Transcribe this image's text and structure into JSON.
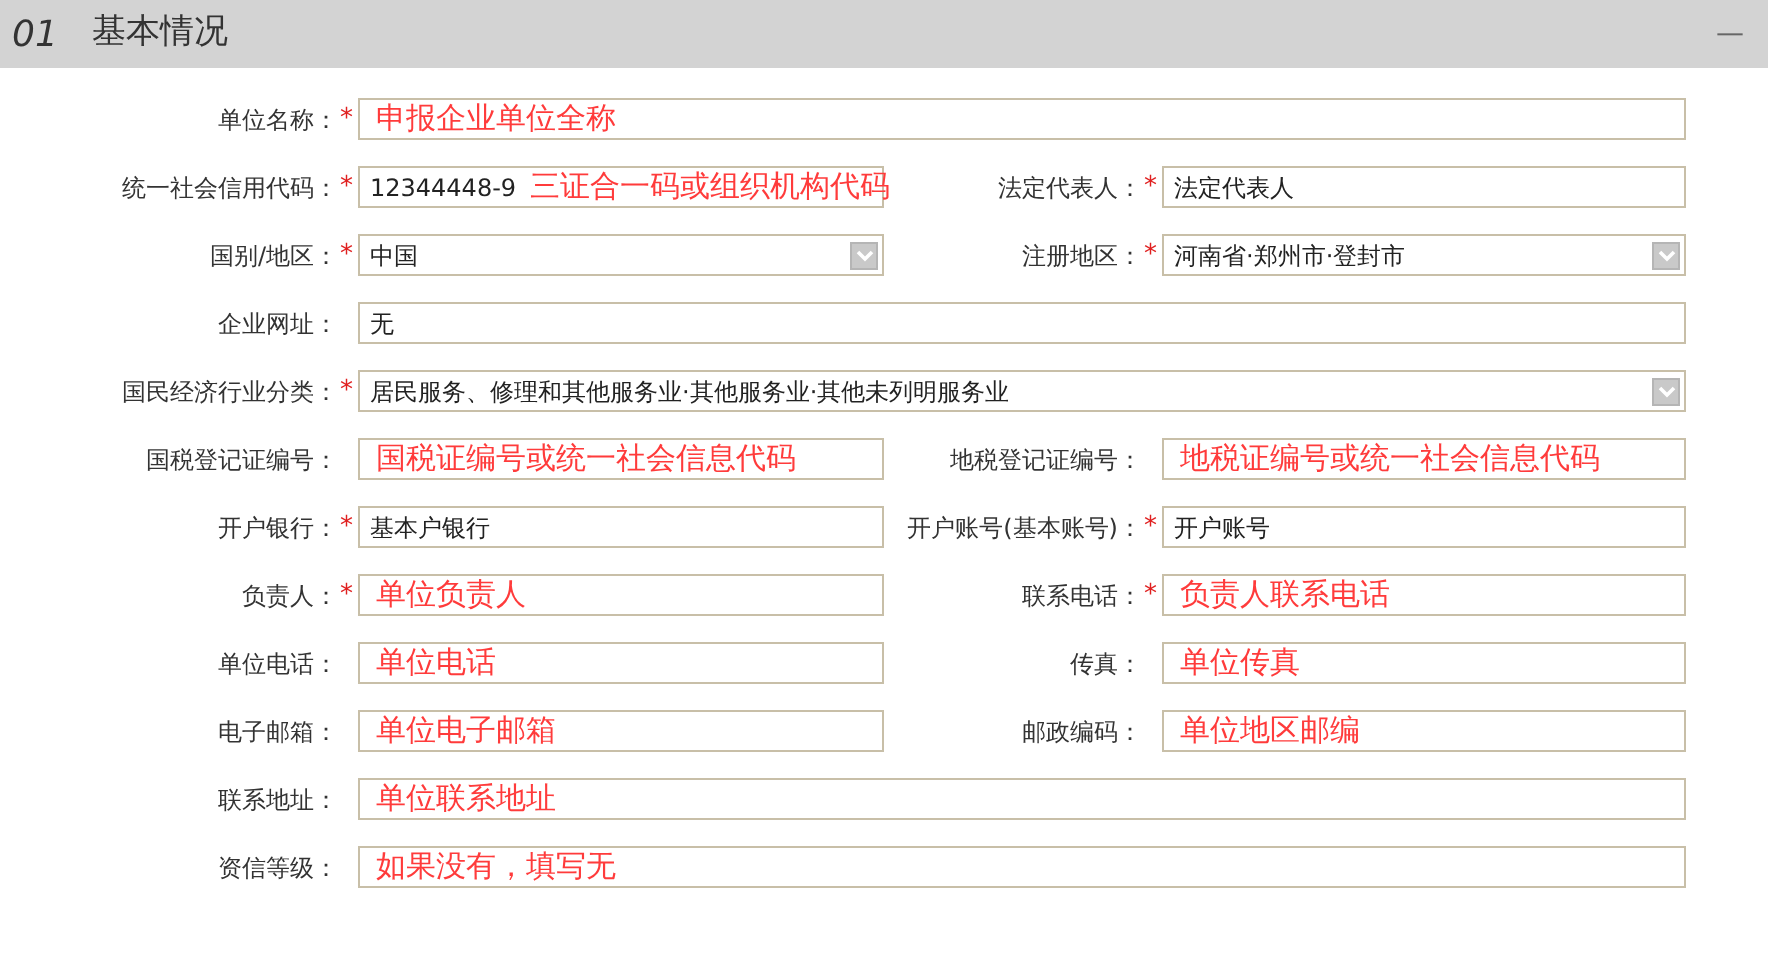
{
  "section": {
    "number": "01",
    "title": "基本情况",
    "collapse": "—"
  },
  "rows": [
    {
      "fields": [
        {
          "label": "单位名称：",
          "required_mark": "*",
          "kind": "text",
          "note": "申报企业单位全称"
        }
      ]
    },
    {
      "fields": [
        {
          "label": "统一社会信用代码：",
          "required_mark": "*",
          "kind": "text",
          "value": "12344448-9",
          "note": "三证合一码或组织机构代码"
        },
        {
          "label": "法定代表人：",
          "required_mark": "*",
          "kind": "text",
          "value": "法定代表人"
        }
      ]
    },
    {
      "fields": [
        {
          "label": "国别/地区：",
          "required_mark": "*",
          "kind": "select",
          "value": "中国"
        },
        {
          "label": "注册地区：",
          "required_mark": "*",
          "kind": "select",
          "value": "河南省·郑州市·登封市"
        }
      ]
    },
    {
      "fields": [
        {
          "label": "企业网址：",
          "kind": "text",
          "value": "无"
        }
      ]
    },
    {
      "fields": [
        {
          "label": "国民经济行业分类：",
          "required_mark": "*",
          "kind": "select",
          "value": "居民服务、修理和其他服务业·其他服务业·其他未列明服务业"
        }
      ]
    },
    {
      "fields": [
        {
          "label": "国税登记证编号：",
          "kind": "text",
          "note": "国税证编号或统一社会信息代码"
        },
        {
          "label": "地税登记证编号：",
          "kind": "text",
          "note": "地税证编号或统一社会信息代码"
        }
      ]
    },
    {
      "fields": [
        {
          "label": "开户银行：",
          "required_mark": "*",
          "kind": "text",
          "value": "基本户银行"
        },
        {
          "label": "开户账号(基本账号)：",
          "required_mark": "*",
          "kind": "text",
          "value": "开户账号"
        }
      ]
    },
    {
      "fields": [
        {
          "label": "负责人：",
          "required_mark": "*",
          "kind": "text",
          "note": "单位负责人"
        },
        {
          "label": "联系电话：",
          "required_mark": "*",
          "kind": "text",
          "note": "负责人联系电话"
        }
      ]
    },
    {
      "fields": [
        {
          "label": "单位电话：",
          "kind": "text",
          "note": "单位电话"
        },
        {
          "label": "传真：",
          "kind": "text",
          "note": "单位传真"
        }
      ]
    },
    {
      "fields": [
        {
          "label": "电子邮箱：",
          "kind": "text",
          "note": "单位电子邮箱"
        },
        {
          "label": "邮政编码：",
          "kind": "text",
          "note": "单位地区邮编"
        }
      ]
    },
    {
      "fields": [
        {
          "label": "联系地址：",
          "kind": "text",
          "note": "单位联系地址"
        }
      ]
    },
    {
      "fields": [
        {
          "label": "资信等级：",
          "kind": "text",
          "note": "如果没有，填写无"
        }
      ]
    }
  ]
}
